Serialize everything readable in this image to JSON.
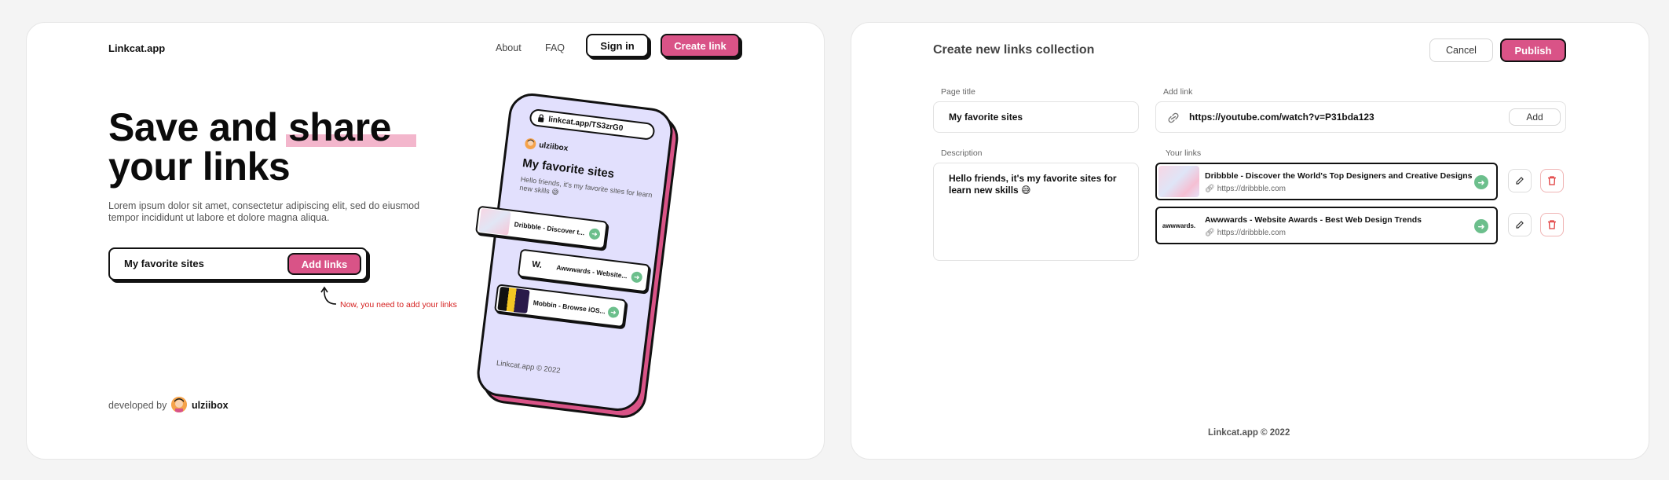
{
  "colors": {
    "accent": "#d95387",
    "highlight": "#f3b6cc",
    "phone_bg": "#e2e0fd",
    "go": "#6cbf8c",
    "hint": "#d5201f"
  },
  "landing": {
    "logo": "Linkcat.app",
    "nav": {
      "about": "About",
      "faq": "FAQ",
      "sign_in": "Sign in",
      "create_link": "Create link"
    },
    "hero": {
      "line1": "Save and share",
      "line2": "your links"
    },
    "lorem": "Lorem ipsum dolor sit amet, consectetur adipiscing elit, sed do eiusmod tempor incididunt ut labore et dolore magna aliqua.",
    "input_value": "My favorite sites",
    "add_button": "Add links",
    "hint": "Now, you need to add your links",
    "developed_by": "developed by",
    "developer": "ulziibox",
    "phone": {
      "url": "linkcat.app/TS3zrG0",
      "user": "ulziibox",
      "title": "My favorite sites",
      "desc": "Hello friends, it's my favorite sites for learn new skills 😅",
      "cards": [
        "Dribbble - Discover t...",
        "Awwwards - Website...",
        "Mobbin - Browse iOS..."
      ],
      "awwwards_mark": "W.",
      "footer": "Linkcat.app © 2022"
    }
  },
  "editor": {
    "title": "Create new links collection",
    "cancel": "Cancel",
    "publish": "Publish",
    "page_title_label": "Page title",
    "page_title_value": "My favorite sites",
    "add_link_label": "Add link",
    "add_link_value": "https://youtube.com/watch?v=P31bda123",
    "add_button": "Add",
    "description_label": "Description",
    "description_value": "Hello friends, it's my favorite sites for learn new skills 😅",
    "your_links_label": "Your links",
    "links": [
      {
        "title": "Dribbble - Discover the World's Top Designers and Creative Designs",
        "url": "https://dribbble.com"
      },
      {
        "title": "Awwwards - Website Awards - Best Web Design Trends",
        "url": "https://dribbble.com",
        "thumb_text": "awwwards."
      }
    ],
    "footer": "Linkcat.app © 2022"
  }
}
